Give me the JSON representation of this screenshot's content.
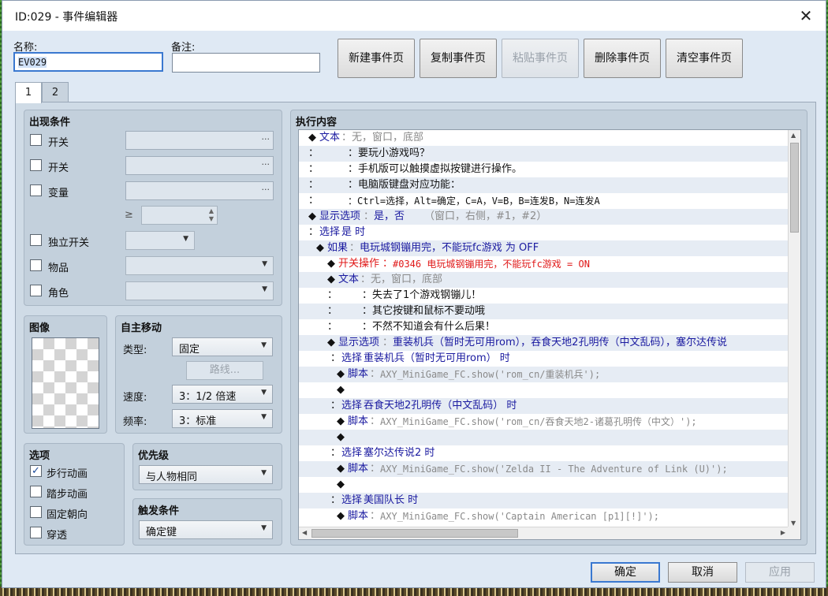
{
  "window": {
    "title": "ID:029 - 事件编辑器"
  },
  "header": {
    "name_label": "名称:",
    "name_value": "EV029",
    "note_label": "备注:",
    "note_value": "",
    "buttons": {
      "new_page": "新建事件页",
      "copy_page": "复制事件页",
      "paste_page": "粘贴事件页",
      "delete_page": "删除事件页",
      "clear_page": "清空事件页"
    }
  },
  "tabs": [
    "1",
    "2"
  ],
  "conditions": {
    "title": "出现条件",
    "switch1": "开关",
    "switch2": "开关",
    "variable": "变量",
    "geq": "≥",
    "self_switch": "独立开关",
    "item": "物品",
    "actor": "角色"
  },
  "image": {
    "title": "图像"
  },
  "autonomous": {
    "title": "自主移动",
    "type_label": "类型:",
    "type_value": "固定",
    "route_label": "路线...",
    "speed_label": "速度:",
    "speed_value": "3：1/2 倍速",
    "freq_label": "频率:",
    "freq_value": "3：标准"
  },
  "options": {
    "title": "选项",
    "walking_anim": "步行动画",
    "walking_anim_checked": "✓",
    "stepping_anim": "踏步动画",
    "direction_fix": "固定朝向",
    "through": "穿透"
  },
  "priority": {
    "title": "优先级",
    "value": "与人物相同"
  },
  "trigger": {
    "title": "触发条件",
    "value": "确定键"
  },
  "contents": {
    "title": "执行内容",
    "lines": [
      {
        "a": "◆",
        "b": "文本",
        "c": "：无，窗口，底部",
        "d": "",
        "e": ""
      },
      {
        "a": "：",
        "b": "",
        "c": "",
        "d": "：要玩小游戏吗？",
        "e": ""
      },
      {
        "a": "：",
        "b": "",
        "c": "",
        "d": "：手机版可以触摸虚拟按键进行操作。",
        "e": ""
      },
      {
        "a": "：",
        "b": "",
        "c": "",
        "d": "：电脑版键盘对应功能：",
        "e": ""
      },
      {
        "a": "：",
        "b": "",
        "c": "",
        "d": "：Ctrl=选择，Alt=确定，C=A，V=B，B=连发B，N=连发A",
        "e": ""
      },
      {
        "a": "◆",
        "b": "显示选项",
        "c": "：",
        "d": "是，否",
        "e": "（窗口，右侧，#1，#2）"
      },
      {
        "a": "：",
        "b": "选择",
        "c": "",
        "d": " 是 时",
        "e": ""
      },
      {
        "a": "◆",
        "b": "如果",
        "c": "：",
        "d": "电玩城钢镚用完，不能玩fc游戏 为 OFF",
        "e": ""
      },
      {
        "a": "◆",
        "b": "开关操作",
        "c": "：",
        "d": "#0346 电玩城钢镚用完，不能玩fc游戏 = ON",
        "e": ""
      },
      {
        "a": "◆",
        "b": "文本",
        "c": "：无，窗口，底部",
        "d": "",
        "e": ""
      },
      {
        "a": "：",
        "b": "",
        "c": "",
        "d": "：失去了1个游戏钢镚儿！",
        "e": ""
      },
      {
        "a": "：",
        "b": "",
        "c": "",
        "d": "：其它按键和鼠标不要动哦",
        "e": ""
      },
      {
        "a": "：",
        "b": "",
        "c": "",
        "d": "：不然不知道会有什么后果！",
        "e": ""
      },
      {
        "a": "◆",
        "b": "显示选项",
        "c": "：",
        "d": "重装机兵（暂时无可用rom），吞食天地2孔明传（中文乱码），塞尔达传说",
        "e": ""
      },
      {
        "a": "：",
        "b": "选择",
        "c": "",
        "d": " 重装机兵（暂时无可用rom） 时",
        "e": ""
      },
      {
        "a": "◆",
        "b": "脚本",
        "c": "：",
        "d": "",
        "e": "AXY_MiniGame_FC.show('rom_cn/重装机兵');"
      },
      {
        "a": "◆",
        "b": "",
        "c": "",
        "d": "",
        "e": ""
      },
      {
        "a": "：",
        "b": "选择",
        "c": "",
        "d": " 吞食天地2孔明传（中文乱码） 时",
        "e": ""
      },
      {
        "a": "◆",
        "b": "脚本",
        "c": "：",
        "d": "",
        "e": "AXY_MiniGame_FC.show('rom_cn/吞食天地2-诸葛孔明传（中文）');"
      },
      {
        "a": "◆",
        "b": "",
        "c": "",
        "d": "",
        "e": ""
      },
      {
        "a": "：",
        "b": "选择",
        "c": "",
        "d": " 塞尔达传说2 时",
        "e": ""
      },
      {
        "a": "◆",
        "b": "脚本",
        "c": "：",
        "d": "",
        "e": "AXY_MiniGame_FC.show('Zelda II - The Adventure of Link (U)');"
      },
      {
        "a": "◆",
        "b": "",
        "c": "",
        "d": "",
        "e": ""
      },
      {
        "a": "：",
        "b": "选择",
        "c": "",
        "d": " 美国队长 时",
        "e": ""
      },
      {
        "a": "◆",
        "b": "脚本",
        "c": "：",
        "d": "",
        "e": "AXY_MiniGame_FC.show('Captain American [p1][!]');"
      }
    ]
  },
  "footer": {
    "ok": "确定",
    "cancel": "取消",
    "apply": "应用"
  },
  "colors": {
    "keyword": "#1a1aa0",
    "red": "#e01818",
    "gray": "#8a8a8a",
    "accent": "#3a78d0"
  }
}
